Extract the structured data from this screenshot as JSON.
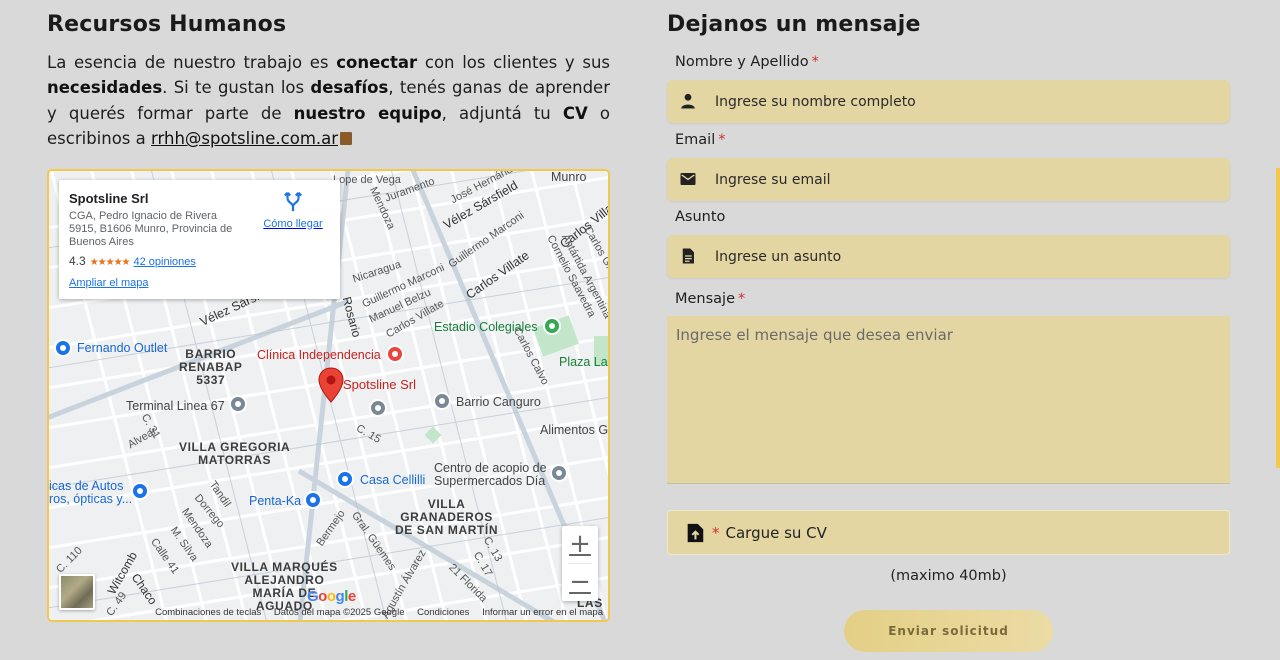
{
  "hr": {
    "title": "Recursos Humanos",
    "p1": "La esencia de nuestro trabajo es ",
    "b1": "conectar",
    "p2": " con los clientes y sus ",
    "b2": "necesidades",
    "p3": ". Si te gustan los ",
    "b3": "desafíos",
    "p4": ", tenés ganas de aprender y querés formar parte de ",
    "b4": "nuestro equipo",
    "p5": ", adjuntá tu ",
    "b5": "CV",
    "p6": " o escribinos a ",
    "email": "rrhh@spotsline.com.ar"
  },
  "map": {
    "place_name": "Spotsline Srl",
    "address": "CGA, Pedro Ignacio de Rivera 5915, B1606 Munro, Provincia de Buenos Aires",
    "rating": "4.3",
    "stars": "★★★★★",
    "reviews": "42 opiniones",
    "enlarge": "Ampliar el mapa",
    "directions": "Cómo llegar",
    "zoom_in": "+",
    "zoom_out": "−",
    "google": "Google",
    "attr_shortcuts": "Combinaciones de teclas",
    "attr_data": "Datos del mapa ©2025 Google",
    "attr_terms": "Condiciones",
    "attr_report": "Informar un error en el mapa",
    "labels": {
      "lope_de_vega": "Lope de Vega",
      "juramento": "Juramento",
      "jose_hernandez": "José Hernández",
      "munro": "Munro",
      "velez1": "Vélez Sársfield",
      "carlos_villate1": "Carlos Villate",
      "mendoza1": "Mendoza",
      "guillermo_marconi1": "Guillermo Marconi",
      "carlos_g": "Carlos G. Malbrán",
      "antartida": "Antártida Argentina",
      "nicaragua": "Nicaragua",
      "guillermo_marconi2": "Guillermo Marconi",
      "carlos_villate2": "Carlos Villate",
      "cornelio": "Cornelio Saavedra",
      "manuel_belzu": "Manuel Belzu",
      "rosario": "Rosario",
      "carlos_villate3": "Carlos Villate",
      "velez2": "Vélez Sársfield",
      "estadio": "Estadio Colegiales",
      "carlos_calvo": "Carlos Calvo",
      "plaza": "Plaza La",
      "fernando_outlet": "Fernando Outlet",
      "barrio_renabap": "BARRIO\nRENABAP\n5337",
      "clinica": "Clínica Independencia",
      "spotsline": "Spotsline Srl",
      "terminal": "Terminal Linea 67",
      "barrio_canguro": "Barrio Canguro",
      "alimentos": "Alimentos G",
      "c31": "C. 31",
      "alvear": "Alvear",
      "c15": "C. 15",
      "villa_gregoria": "VILLA GREGORIA\nMATORRAS",
      "centro_acopio": "Centro de acopio de\nSupermercados Día",
      "casa_cellilli": "Casa Cellilli",
      "autos": "icas de Autos\nros, ópticas y...",
      "tandil": "Tandil",
      "dorrego": "Dorrego",
      "penta_ka": "Penta-Ka",
      "villa_granaderos": "VILLA\nGRANADEROS\nDE SAN MARTÍN",
      "bermejo": "Bermejo",
      "gral_guemes": "Gral. Güemes",
      "c13": "C. 13",
      "c17": "C. 17",
      "mendoza2": "Mendoza",
      "msilva": "M. Silva",
      "calle41": "Calle 41",
      "c110": "C. 110",
      "witcomb": "Witcomb",
      "chaco": "Chaco",
      "c49": "C. 49",
      "villa_marques": "VILLA MARQUÉS\nALEJANDRO\nMARÍA DE\nAGUADO",
      "agustin_alvarez": "Agustín Álvarez",
      "florida": "21 Florida",
      "las": "LAS"
    }
  },
  "form": {
    "title": "Dejanos un mensaje",
    "name_label": "Nombre y Apellido",
    "name_placeholder": "Ingrese su nombre completo",
    "email_label": "Email",
    "email_placeholder": "Ingrese su email",
    "subject_label": "Asunto",
    "subject_placeholder": "Ingrese un asunto",
    "message_label": "Mensaje",
    "message_placeholder": "Ingrese el mensaje que desea enviar",
    "required_mark": "*",
    "cv_label": "Cargue su CV",
    "cv_note": "(maximo 40mb)",
    "submit": "Enviar solicitud"
  },
  "colors": {
    "accent": "#f2c94c",
    "field_bg": "#e4d6a2",
    "required": "#d32f2f",
    "page_bg": "#d9d9d9"
  },
  "icons": {
    "name": "person-icon",
    "email": "envelope-icon",
    "subject": "document-icon",
    "cv": "upload-file-icon",
    "directions": "directions-icon",
    "email_link": "book-icon"
  }
}
